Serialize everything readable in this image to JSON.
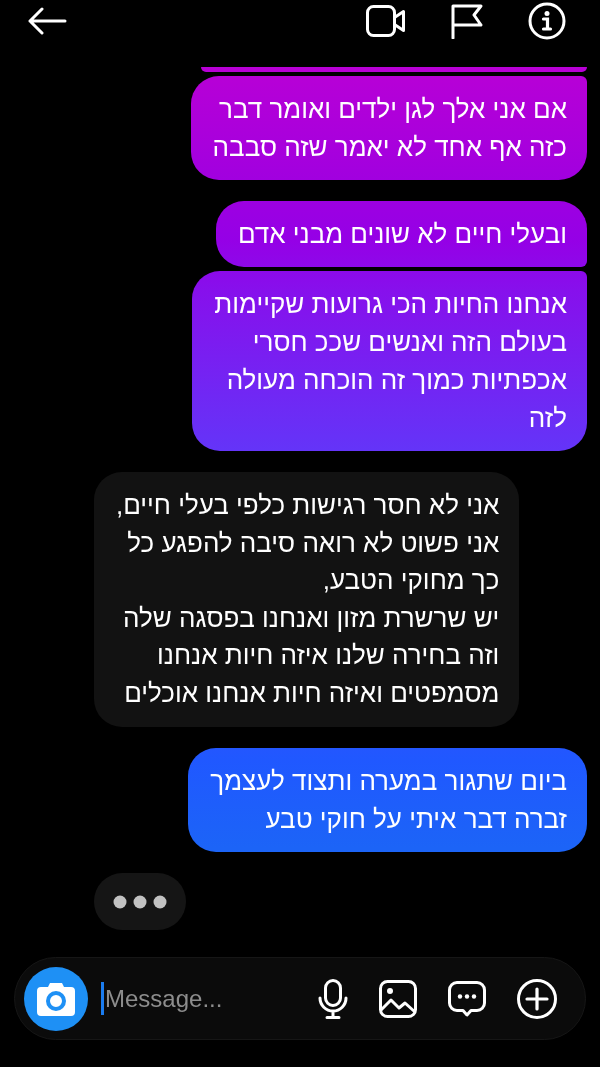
{
  "conversation": {
    "groups": [
      {
        "kind": "sent",
        "clipped_above": true,
        "messages": [
          "אם אני אלך לגן ילדים ואומר דבר\nכזה אף אחד לא יאמר שזה סבבה"
        ]
      },
      {
        "kind": "sent",
        "clipped_above": false,
        "messages": [
          "ובעלי חיים לא שונים מבני אדם",
          "אנחנו החיות הכי גרועות שקיימות\nבעולם הזה ואנשים שככ חסרי\nאכפתיות כמוך זה הוכחה מעולה\nלזה"
        ]
      },
      {
        "kind": "received",
        "clipped_above": false,
        "messages": [
          "אני לא חסר רגישות כלפי בעלי חיים,\nאני פשוט לא רואה סיבה להפגע כל\nכך מחוקי הטבע,\nיש שרשרת מזון ואנחנו בפסגה שלה\nוזה בחירה שלנו איזה חיות אנחנו\nמסמפטים ואיזה חיות אנחנו אוכלים"
        ]
      },
      {
        "kind": "sent",
        "clipped_above": false,
        "messages": [
          "ביום שתגור במערה ותצוד לעצמך\nזברה דבר איתי על חוקי טבע"
        ]
      }
    ],
    "typing_indicator": true
  },
  "composer": {
    "placeholder": "Message..."
  }
}
